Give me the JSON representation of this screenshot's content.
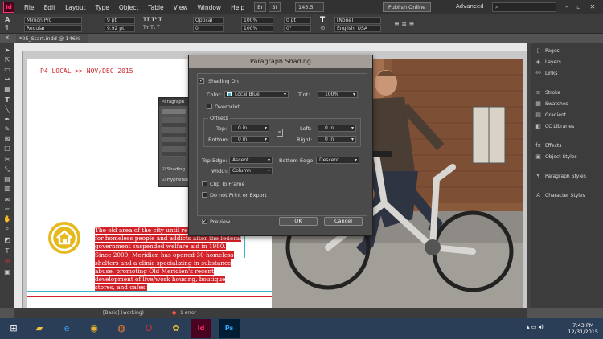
{
  "app": {
    "logo": "Id",
    "bridge": "Br",
    "stock": "St",
    "zoom": "145.5",
    "publish_label": "Publish Online",
    "workspace": "Advanced"
  },
  "menu": [
    "File",
    "Edit",
    "Layout",
    "Type",
    "Object",
    "Table",
    "View",
    "Window",
    "Help"
  ],
  "control_bar": {
    "font_family": "Minion Pro",
    "font_style": "Regular",
    "font_size": "9 pt",
    "leading": "9.92 pt",
    "kerning": "Optical",
    "tracking": "0",
    "vscale": "100%",
    "hscale": "100%",
    "baseline": "0 pt",
    "skew": "0°",
    "language": "English: USA",
    "char_style": "[None]"
  },
  "document_tab": {
    "label": "*05_Start.indd @ 146%"
  },
  "layout": {
    "header_text": "P4  LOCAL >> NOV/DEC 2015",
    "body_text": "The old area of the city until recently was home for homeless people and addicts after the federal government suspended welfare aid in 1980. Since 2000, Meridien has opened 30 homeless shelters and a clinic specializing in substance abuse, promoting Old Meridien's recent development of live/work housing, boutique stores, and cafes.",
    "accent_color": "#d2232a",
    "highlight_color": "#3ab7c2",
    "icon_color": "#e6b91e"
  },
  "mini_panel": {
    "title": "Paragraph",
    "shading_label": "Shading",
    "hyphenate_label": "Hyphenate"
  },
  "dialog": {
    "title": "Paragraph Shading",
    "shading_on": "Shading On",
    "color_label": "Color:",
    "color_value": "Local Blue",
    "tint_label": "Tint:",
    "tint_value": "100%",
    "overprint": "Overprint",
    "offsets_label": "Offsets",
    "top_label": "Top:",
    "top_value": "0 in",
    "bottom_label": "Bottom:",
    "bottom_value": "0 in",
    "left_label": "Left:",
    "left_value": "0 in",
    "right_label": "Right:",
    "right_value": "0 in",
    "top_edge_label": "Top Edge:",
    "top_edge_value": "Ascent",
    "bottom_edge_label": "Bottom Edge:",
    "bottom_edge_value": "Descent",
    "width_label": "Width:",
    "width_value": "Column",
    "clip_to_frame": "Clip To Frame",
    "no_print": "Do not Print or Export",
    "preview": "Preview",
    "ok": "OK",
    "cancel": "Cancel",
    "swatch_color": "#3ab7c2"
  },
  "panels": [
    "Pages",
    "Layers",
    "Links",
    "Stroke",
    "Swatches",
    "Gradient",
    "CC Libraries",
    "Effects",
    "Object Styles",
    "Paragraph Styles",
    "Character Styles"
  ],
  "status": {
    "preflight_profile": "[Basic] (working)",
    "errors": "1 error"
  },
  "taskbar": {
    "time": "7:43 PM",
    "date": "12/31/2015"
  }
}
